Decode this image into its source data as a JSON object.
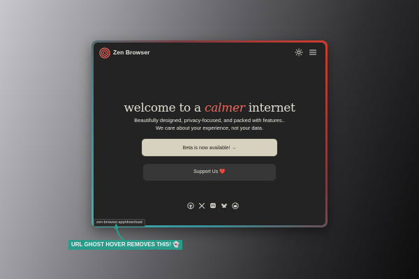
{
  "header": {
    "brand_name": "Zen Browser",
    "logo_icon": "zen-logo-icon",
    "theme_icon": "sun-icon",
    "menu_icon": "hamburger-menu-icon"
  },
  "hero": {
    "title_before": "welcome to a",
    "title_accent": "calmer",
    "title_after": "internet",
    "subtitle_line1": "Beautifully designed, privacy-focused, and packed with features..",
    "subtitle_line2": "We care about your experience, not your data."
  },
  "actions": {
    "beta_label": "Beta is now available!",
    "beta_arrow": "→",
    "support_label": "Support Us",
    "support_heart": "❤️"
  },
  "socials": [
    {
      "name": "github-icon"
    },
    {
      "name": "x-icon"
    },
    {
      "name": "mastodon-icon"
    },
    {
      "name": "bluesky-icon"
    },
    {
      "name": "reddit-icon"
    }
  ],
  "status_url": "zen-browser.app/download",
  "annotation": "URL GHOST HOVER REMOVES THIS! 👻",
  "colors": {
    "accent": "#f0685a",
    "window_bg": "#232323",
    "beta_button_bg": "#d6d2bf",
    "support_button_bg": "#373737",
    "annotation_bg": "#2a9d8a",
    "border_teal": "#35b3b0",
    "border_red": "#d23c2c"
  }
}
